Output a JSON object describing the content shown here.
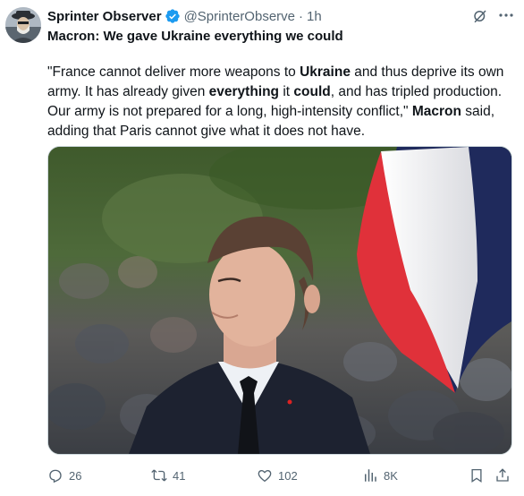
{
  "author": {
    "name": "Sprinter Observer",
    "handle": "@SprinterObserve",
    "separator": "·",
    "time": "1h",
    "verified_color": "#1d9bf0"
  },
  "tweet": {
    "headline": "Macron: We gave Ukraine everything we could",
    "body": {
      "p1": " \"France cannot deliver more weapons to ",
      "b1": "Ukraine",
      "p2": " and thus deprive its own army. It has already given ",
      "b2": "everything",
      "p3": " it ",
      "b3": "could",
      "p4": ", and has tripled production. Our army is not prepared for a long, high-intensity conflict,\" ",
      "b4": "Macron",
      "p5": " said, adding that Paris cannot give what it does not have."
    }
  },
  "actions": {
    "replies": "26",
    "reposts": "41",
    "likes": "102",
    "views": "8K"
  },
  "icons": {
    "reply": "reply-icon",
    "repost": "repost-icon",
    "like": "like-icon",
    "views": "views-icon",
    "bookmark": "bookmark-icon",
    "share": "share-icon",
    "grok": "grok-icon",
    "more": "more-icon"
  }
}
